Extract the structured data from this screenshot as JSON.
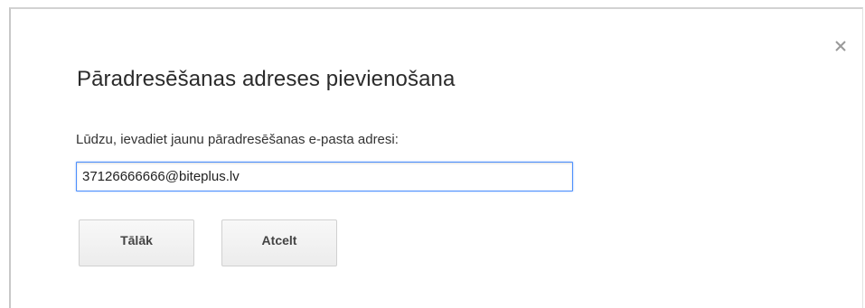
{
  "dialog": {
    "title": "Pāradresēšanas adreses pievienošana",
    "close_icon": "close-icon",
    "prompt": "Lūdzu, ievadiet jaunu pāradresēšanas e-pasta adresi:",
    "email_value": "37126666666@biteplus.lv",
    "next_label": "Tālāk",
    "cancel_label": "Atcelt"
  },
  "colors": {
    "input_focus_border": "#4d90fe",
    "button_background": "#f3f3f3",
    "title_text": "#2b2b2b"
  }
}
